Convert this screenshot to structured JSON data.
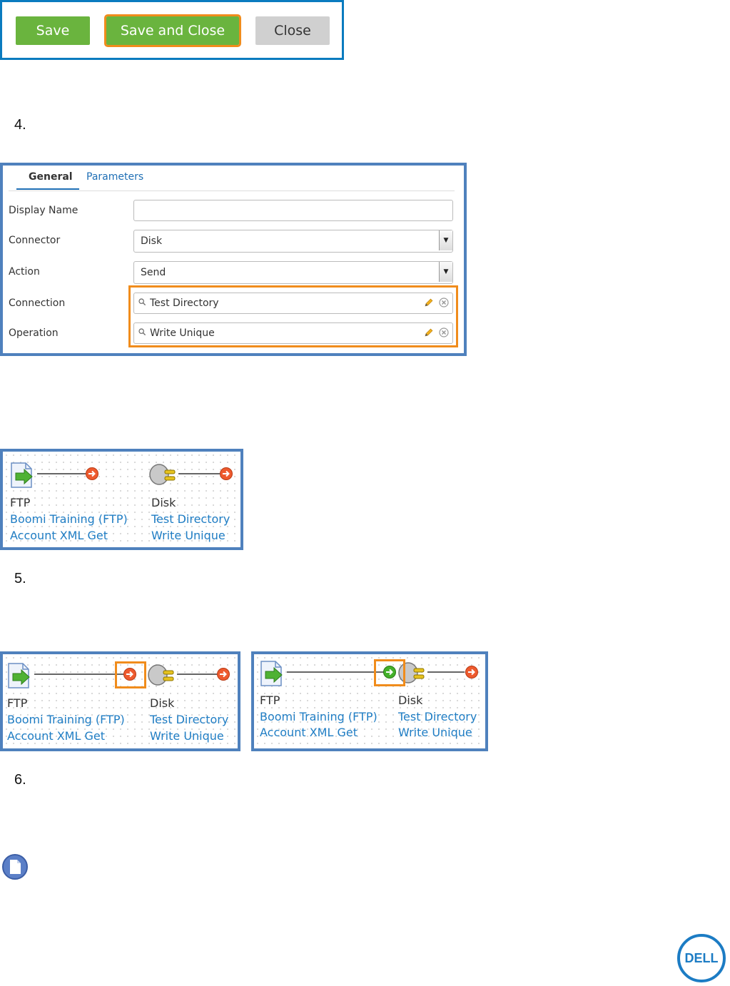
{
  "buttons": {
    "save": "Save",
    "save_close": "Save and Close",
    "close": "Close"
  },
  "steps": {
    "s4": "4.",
    "s5": "5.",
    "s6": "6."
  },
  "form": {
    "tabs": [
      "General",
      "Parameters"
    ],
    "fields": {
      "display_name": {
        "label": "Display Name",
        "value": ""
      },
      "connector": {
        "label": "Connector",
        "value": "Disk"
      },
      "action": {
        "label": "Action",
        "value": "Send"
      },
      "connection": {
        "label": "Connection",
        "value": "Test Directory"
      },
      "operation": {
        "label": "Operation",
        "value": "Write Unique"
      }
    }
  },
  "shapes": {
    "ftp": {
      "type": "FTP",
      "connection": "Boomi Training (FTP)",
      "operation": "Account XML Get"
    },
    "disk": {
      "type": "Disk",
      "connection": "Test Directory",
      "operation": "Write Unique"
    }
  },
  "colors": {
    "accent_blue": "#4f81bd",
    "highlight": "#f08c1c",
    "button_green": "#6ab43e",
    "link": "#1f7dc4"
  }
}
